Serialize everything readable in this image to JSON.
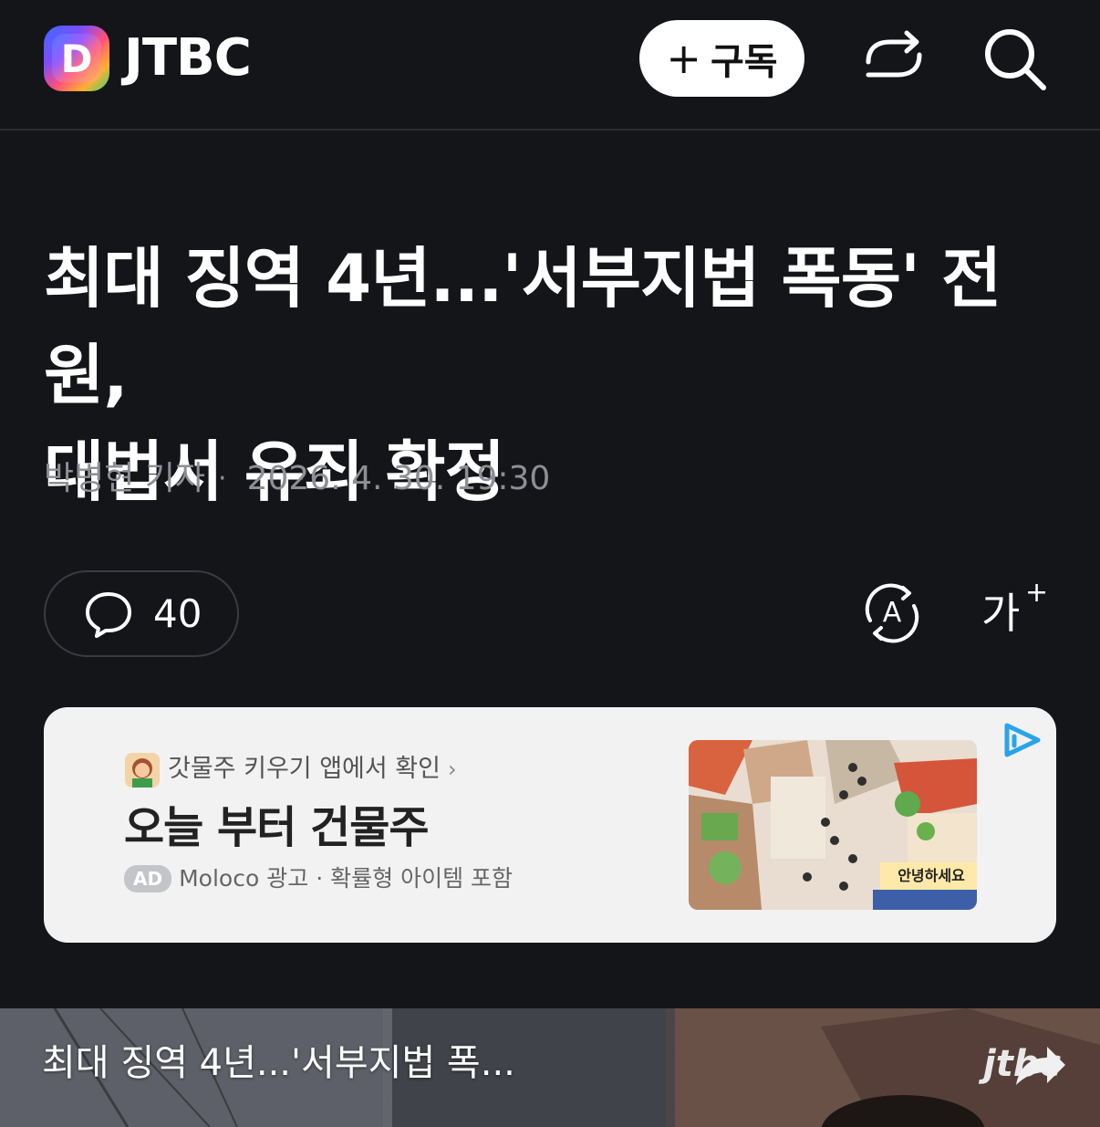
{
  "header": {
    "logo_letter": "D",
    "brand": "JTBC",
    "subscribe_label": "구독",
    "icons": [
      "share-icon",
      "search-icon"
    ]
  },
  "article": {
    "title_line1": "최대 징역 4년...'서부지법 폭동' 전원,",
    "title_line2": "대법서 유죄 확정",
    "author": "박병현 기자",
    "separator": "·",
    "date": "2026. 4. 30. 19:30"
  },
  "toolbar": {
    "comment_count": "40",
    "fontsize_label": "가"
  },
  "ad": {
    "app_line": "갓물주 키우기 앱에서 확인",
    "headline": "오늘 부터 건물주",
    "badge": "AD",
    "advertiser": "Moloco 광고",
    "info_sep": "·",
    "disclaimer": "확률형 아이템 포함",
    "image_sign": "안녕하세요"
  },
  "video": {
    "title": "최대 징역 4년...'서부지법 폭...",
    "logo": "jtbc"
  },
  "colors": {
    "background": "#141519",
    "title": "#ffffff",
    "meta": "#8e8f94",
    "ad_card": "#f2f2f3",
    "ad_choice": "#2aa3e8"
  }
}
